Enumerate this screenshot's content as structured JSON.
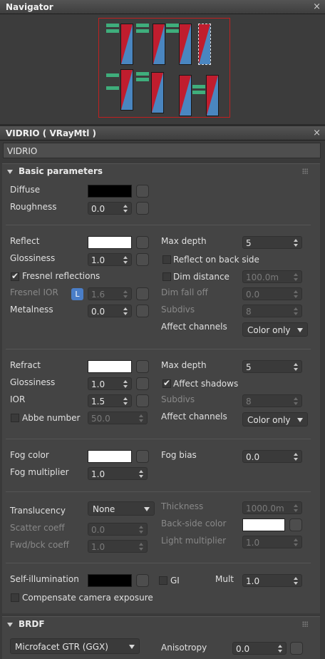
{
  "navigator": {
    "title": "Navigator",
    "close": "×"
  },
  "material": {
    "title": "VIDRIO  ( VRayMtl )",
    "close": "×",
    "name": "VIDRIO"
  },
  "basic": {
    "header": "Basic parameters",
    "diffuse": {
      "label": "Diffuse",
      "color": "#000000"
    },
    "roughness": {
      "label": "Roughness",
      "value": "0.0"
    },
    "reflect": {
      "label": "Reflect",
      "color": "#ffffff"
    },
    "glossiness": {
      "label": "Glossiness",
      "value": "1.0"
    },
    "fresnel": {
      "label": "Fresnel reflections",
      "checked": true
    },
    "fresnel_ior": {
      "label": "Fresnel IOR",
      "lock": "L",
      "value": "1.6"
    },
    "metalness": {
      "label": "Metalness",
      "value": "0.0"
    },
    "refl_max_depth": {
      "label": "Max depth",
      "value": "5"
    },
    "reflect_back": {
      "label": "Reflect on back side",
      "checked": false
    },
    "dim_distance": {
      "label": "Dim distance",
      "checked": false,
      "value": "100.0m"
    },
    "dim_falloff": {
      "label": "Dim fall off",
      "value": "0.0"
    },
    "refl_subdivs": {
      "label": "Subdivs",
      "value": "8"
    },
    "refl_affect": {
      "label": "Affect channels",
      "value": "Color only"
    },
    "refract": {
      "label": "Refract",
      "color": "#ffffff"
    },
    "refr_glossiness": {
      "label": "Glossiness",
      "value": "1.0"
    },
    "ior": {
      "label": "IOR",
      "value": "1.5"
    },
    "abbe": {
      "label": "Abbe number",
      "checked": false,
      "value": "50.0"
    },
    "refr_max_depth": {
      "label": "Max depth",
      "value": "5"
    },
    "affect_shadows": {
      "label": "Affect shadows",
      "checked": true
    },
    "refr_subdivs": {
      "label": "Subdivs",
      "value": "8"
    },
    "refr_affect": {
      "label": "Affect channels",
      "value": "Color only"
    },
    "fog_color": {
      "label": "Fog color",
      "color": "#ffffff"
    },
    "fog_bias": {
      "label": "Fog bias",
      "value": "0.0"
    },
    "fog_mult": {
      "label": "Fog multiplier",
      "value": "1.0"
    },
    "translucency": {
      "label": "Translucency",
      "value": "None"
    },
    "thickness": {
      "label": "Thickness",
      "value": "1000.0m"
    },
    "scatter": {
      "label": "Scatter coeff",
      "value": "0.0"
    },
    "backside": {
      "label": "Back-side color",
      "color": "#ffffff"
    },
    "fwdbck": {
      "label": "Fwd/bck coeff",
      "value": "1.0"
    },
    "light_mult": {
      "label": "Light multiplier",
      "value": "1.0"
    },
    "self_illum": {
      "label": "Self-illumination",
      "color": "#000000"
    },
    "gi": {
      "label": "GI",
      "checked": false
    },
    "mult": {
      "label": "Mult",
      "value": "1.0"
    },
    "compensate": {
      "label": "Compensate camera exposure",
      "checked": false
    }
  },
  "brdf": {
    "header": "BRDF",
    "type": "Microfacet GTR (GGX)",
    "anisotropy": {
      "label": "Anisotropy",
      "value": "0.0"
    }
  }
}
